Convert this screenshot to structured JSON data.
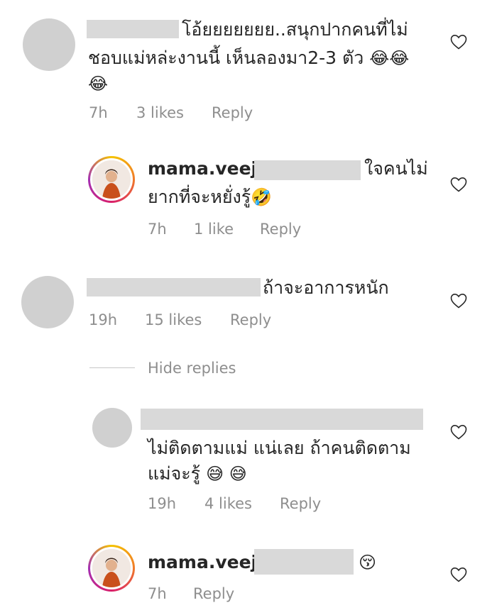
{
  "comments": [
    {
      "line1": "โอ้ยยยยยยย..สนุกปากคนที่ไม่",
      "line2": "ชอบแม่หล่ะงานนี้ เห็นลองมา2-3 ตัว",
      "emoji_inline": "😂😂",
      "line3_emoji": "😂",
      "time": "7h",
      "likes": "3 likes",
      "reply_label": "Reply"
    },
    {
      "username": "mama.veeji",
      "line1": "ใจคนไม่",
      "line2": "ยากที่จะหยั่งรู้",
      "emoji": "🤣",
      "time": "7h",
      "likes": "1 like",
      "reply_label": "Reply"
    },
    {
      "line1": "ถ้าจะอาการหนัก",
      "time": "19h",
      "likes": "15 likes",
      "reply_label": "Reply"
    },
    {
      "line1": "ไม่ติดตามแม่  แน่เลย ถ้าคนติดตาม",
      "line2": "แม่จะรู้",
      "emoji": "😅 😅",
      "time": "19h",
      "likes": "4 likes",
      "reply_label": "Reply"
    },
    {
      "username": "mama.veeji",
      "emoji": "😚",
      "time": "7h",
      "reply_label": "Reply"
    }
  ],
  "hide_replies_label": "Hide replies",
  "icons": {
    "like": "heart-outline-icon"
  },
  "colors": {
    "meta": "#8e8e8e",
    "text": "#262626",
    "redaction": "#d9d9d9"
  }
}
